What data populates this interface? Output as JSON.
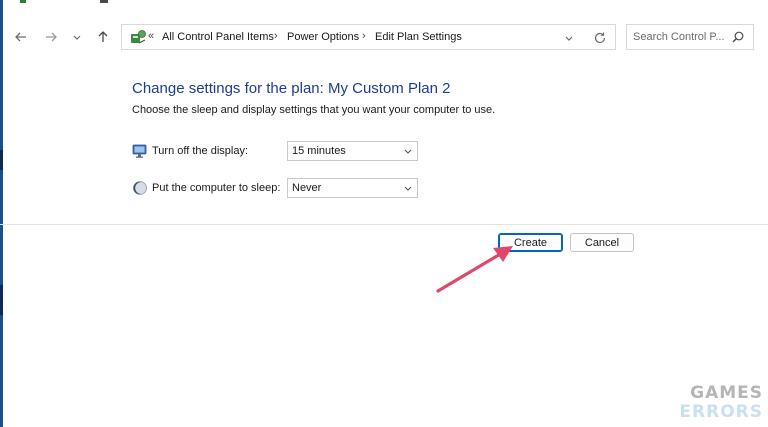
{
  "nav": {
    "back": "back-arrow-icon",
    "forward": "forward-arrow-icon",
    "recent": "chevron-down-icon",
    "up": "up-arrow-icon"
  },
  "address": {
    "overflow": "«",
    "separator": "›",
    "crumbs": [
      "All Control Panel Items",
      "Power Options",
      "Edit Plan Settings"
    ]
  },
  "search": {
    "placeholder": "Search Control P..."
  },
  "content": {
    "title": "Change settings for the plan: My Custom Plan 2",
    "subtitle": "Choose the sleep and display settings that you want your computer to use.",
    "settings": [
      {
        "label": "Turn off the display:",
        "value": "15 minutes",
        "icon": "monitor-icon"
      },
      {
        "label": "Put the computer to sleep:",
        "value": "Never",
        "icon": "sleep-moon-icon"
      }
    ]
  },
  "buttons": {
    "create": "Create",
    "cancel": "Cancel"
  },
  "watermark": {
    "line1": "GAMES",
    "line2": "ERRORS"
  },
  "colors": {
    "title": "#1e3d8f",
    "accent": "#0067c0",
    "arrow": "#e0476a"
  }
}
